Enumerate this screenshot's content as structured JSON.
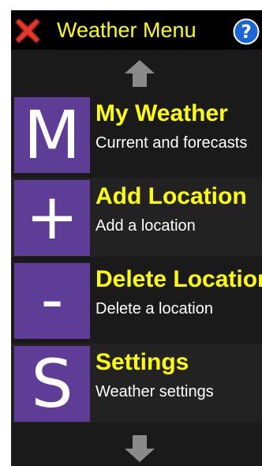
{
  "header": {
    "title": "Weather Menu",
    "close_icon": "red-x-icon",
    "help_icon": "question-mark-icon",
    "help_glyph": "?"
  },
  "nav": {
    "up_icon": "up-arrow-icon",
    "down_icon": "down-arrow-icon"
  },
  "menu": [
    {
      "letter": "M",
      "title": "My Weather",
      "subtitle": "Current and forecasts"
    },
    {
      "letter": "+",
      "title": "Add Location",
      "subtitle": "Add a location"
    },
    {
      "letter": "-",
      "title": "Delete Location",
      "subtitle": "Delete a location"
    },
    {
      "letter": "S",
      "title": "Settings",
      "subtitle": "Weather settings"
    }
  ],
  "colors": {
    "title_text": "#ffff00",
    "tile_background": "#5e3d96",
    "help_blue": "#1a66d6",
    "close_red": "#e23a2a"
  }
}
